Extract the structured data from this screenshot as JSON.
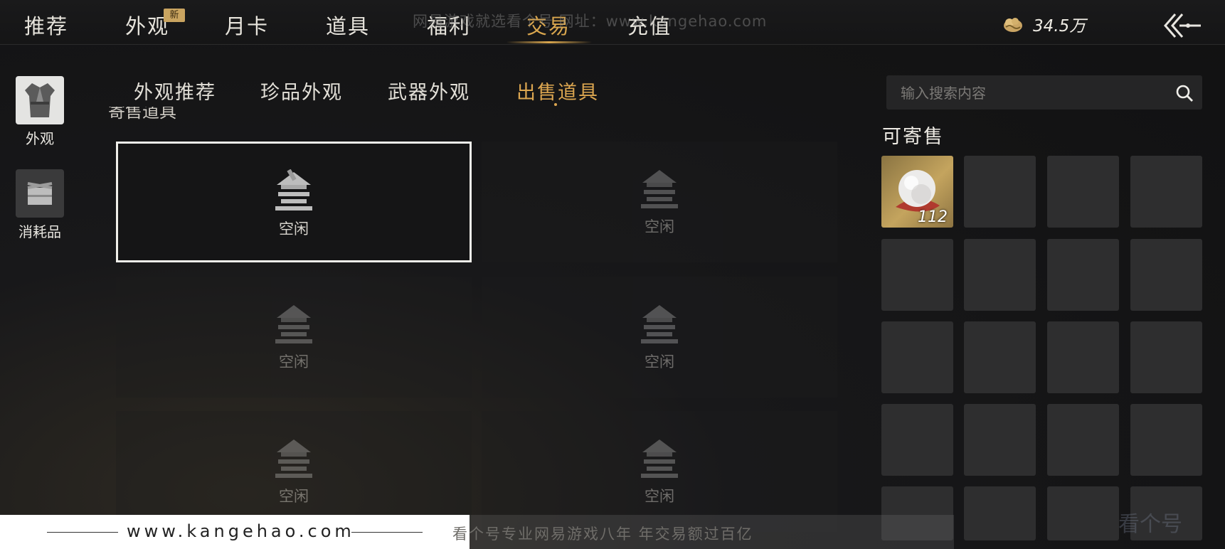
{
  "top_tabs": [
    {
      "label": "推荐",
      "active": false
    },
    {
      "label": "外观",
      "active": false,
      "badge": "新"
    },
    {
      "label": "月卡",
      "active": false
    },
    {
      "label": "道具",
      "active": false
    },
    {
      "label": "福利",
      "active": false
    },
    {
      "label": "交易",
      "active": true
    },
    {
      "label": "充值",
      "active": false
    }
  ],
  "currency": {
    "amount": "34.5万",
    "icon": "coin-cloud-icon"
  },
  "sidebar": {
    "items": [
      {
        "label": "外观",
        "icon": "robe-icon"
      },
      {
        "label": "消耗品",
        "icon": "consumable-icon"
      }
    ]
  },
  "sub_tabs": [
    {
      "label": "外观推荐",
      "active": false
    },
    {
      "label": "珍品外观",
      "active": false
    },
    {
      "label": "武器外观",
      "active": false
    },
    {
      "label": "出售道具",
      "active": true
    }
  ],
  "section_cut_text": "寄售道具",
  "slots": [
    {
      "label": "空闲",
      "selected": true
    },
    {
      "label": "空闲",
      "selected": false
    },
    {
      "label": "空闲",
      "selected": false
    },
    {
      "label": "空闲",
      "selected": false
    },
    {
      "label": "空闲",
      "selected": false
    },
    {
      "label": "空闲",
      "selected": false
    }
  ],
  "search": {
    "placeholder": "输入搜索内容"
  },
  "sellable": {
    "title": "可寄售",
    "items": [
      {
        "name": "pearl",
        "count": "112",
        "icon": "pearl-icon"
      }
    ]
  },
  "footer": {
    "url": "www.kangehao.com",
    "slogan": "看个号专业网易游戏八年    年交易额过百亿"
  },
  "watermark": {
    "top": "网易游戏就选看个号   网址：www.kangehao.com",
    "corner": "看个号"
  },
  "colors": {
    "accent": "#d9a64e",
    "panel": "#2e2e2f",
    "background": "#151516"
  }
}
